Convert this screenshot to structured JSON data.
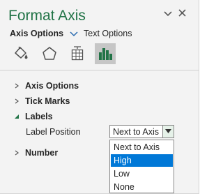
{
  "pane": {
    "title": "Format Axis"
  },
  "tabs": {
    "axis_options": "Axis Options",
    "text_options": "Text Options"
  },
  "icons": [
    "fill-line-icon",
    "effects-icon",
    "size-properties-icon",
    "axis-options-icon"
  ],
  "sections": {
    "axis_options": "Axis Options",
    "tick_marks": "Tick Marks",
    "labels": "Labels",
    "number": "Number"
  },
  "labels": {
    "label_position_label": "Label Position",
    "label_position_value": "Next to Axis",
    "options": [
      "Next to Axis",
      "High",
      "Low",
      "None"
    ],
    "selected_option": "High"
  },
  "colors": {
    "title": "#217346",
    "accent": "#217346",
    "selection": "#0078d7"
  }
}
